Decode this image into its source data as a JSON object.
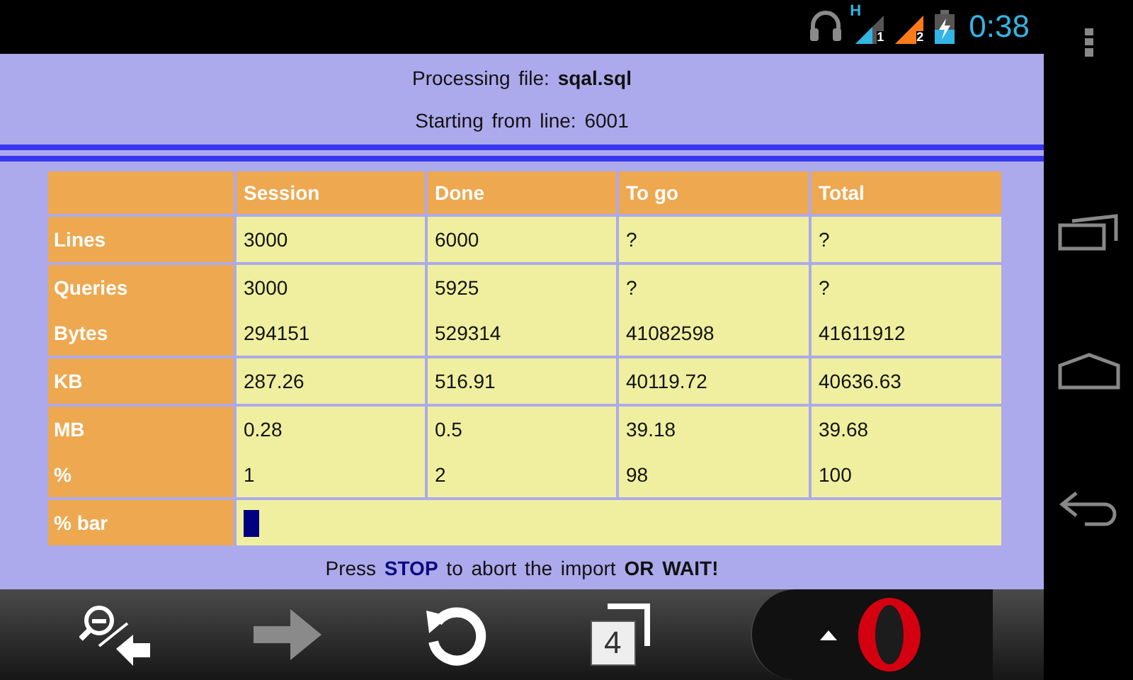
{
  "status_bar": {
    "network_type": "H",
    "sims": [
      "1",
      "2"
    ],
    "time": "0:38"
  },
  "header": {
    "file_label": "Processing  file:",
    "file_name": "sqal.sql",
    "start_label": "Starting  from  line:",
    "start_line": "6001"
  },
  "table": {
    "columns": [
      "Session",
      "Done",
      "To  go",
      "Total"
    ],
    "rows": [
      {
        "lines": [
          {
            "label": "Lines",
            "values": [
              "3000",
              "6000",
              "?",
              "?"
            ]
          }
        ]
      },
      {
        "lines": [
          {
            "label": "Queries",
            "values": [
              "3000",
              "5925",
              "?",
              "?"
            ]
          },
          {
            "label": "Bytes",
            "values": [
              "294151",
              "529314",
              "41082598",
              "41611912"
            ]
          }
        ]
      },
      {
        "lines": [
          {
            "label": "KB",
            "values": [
              "287.26",
              "516.91",
              "40119.72",
              "40636.63"
            ]
          }
        ]
      },
      {
        "lines": [
          {
            "label": "MB",
            "values": [
              "0.28",
              "0.5",
              "39.18",
              "39.68"
            ]
          },
          {
            "label": "%",
            "values": [
              "1",
              "2",
              "98",
              "100"
            ]
          }
        ]
      }
    ],
    "bar": {
      "label": "%  bar",
      "level": 0.02
    }
  },
  "footer": "Press  **STOP**  to  abort  the  import  **OR  WAIT!**",
  "toolbar": {
    "tab_count": "4"
  }
}
